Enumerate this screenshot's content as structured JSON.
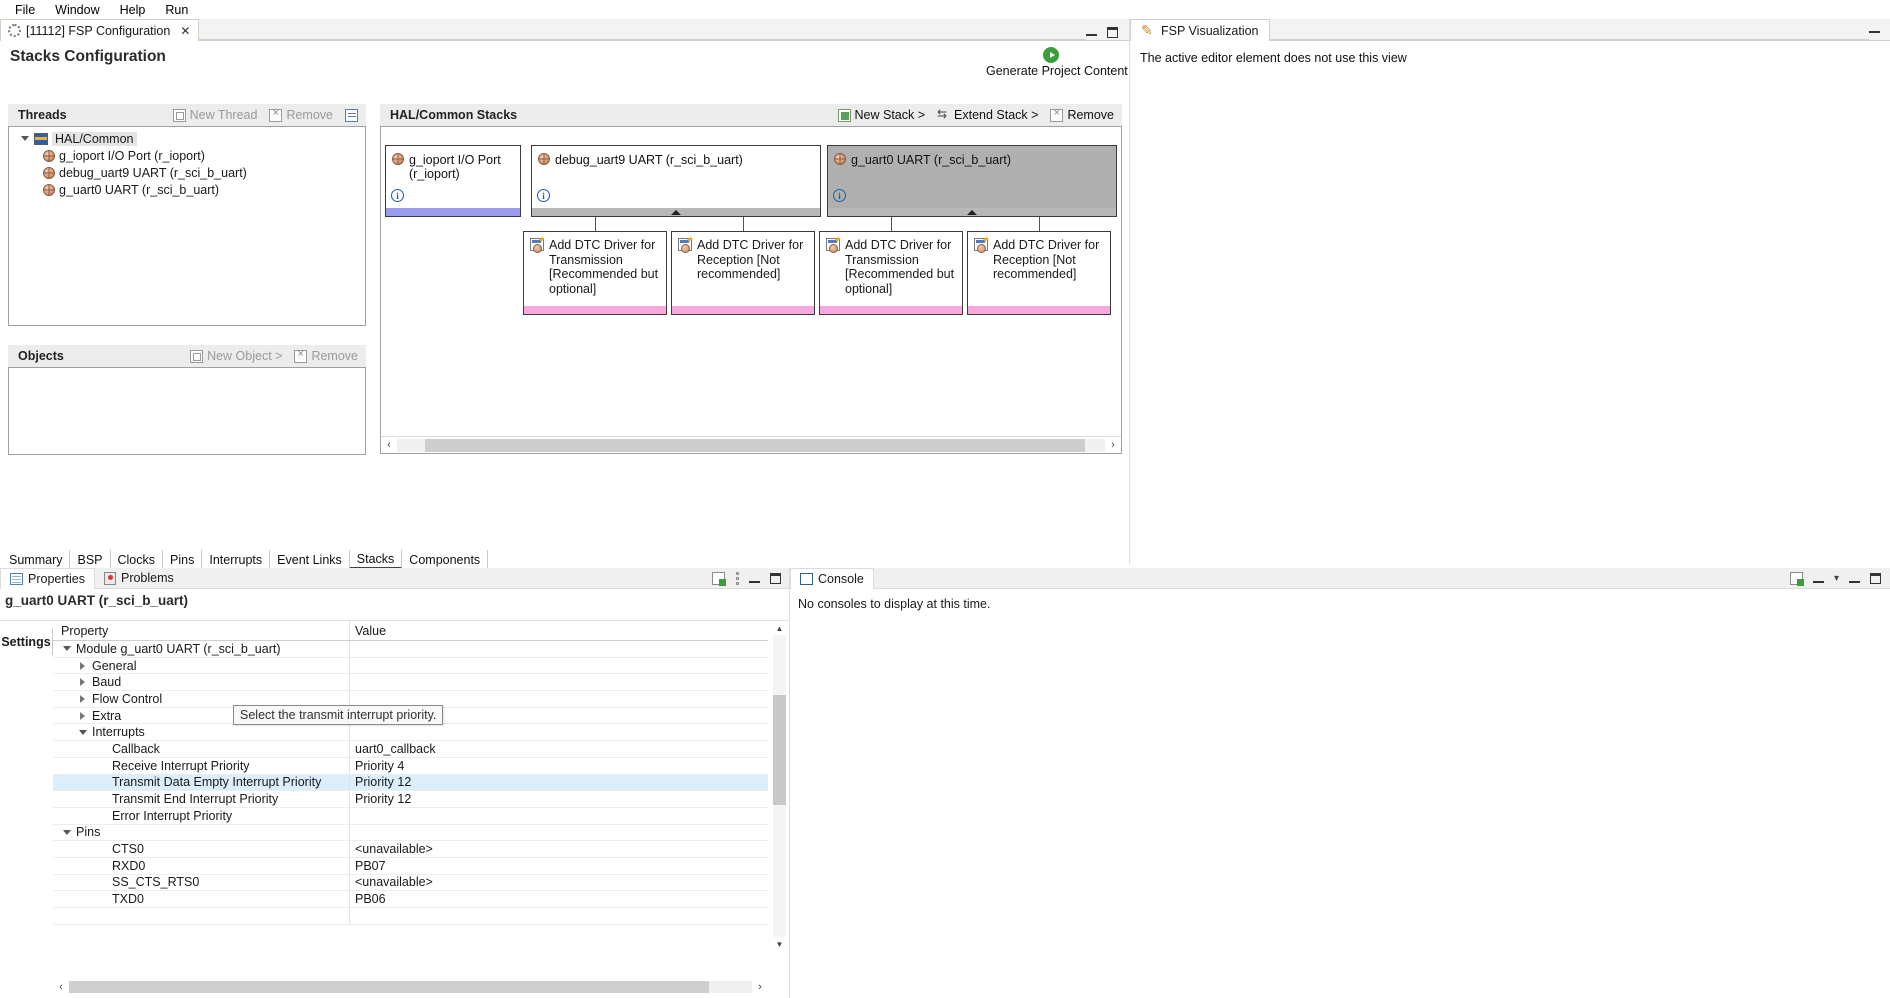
{
  "menu": {
    "items": [
      "File",
      "Window",
      "Help",
      "Run"
    ]
  },
  "editor": {
    "tab_label": "[11112] FSP Configuration",
    "close_icon": "✕",
    "title": "Stacks Configuration",
    "generate_label": "Generate Project Content",
    "generate_icon": "play-circle-icon",
    "window_minimize": "minimize-icon",
    "window_maximize": "maximize-icon"
  },
  "threads": {
    "header": "Threads",
    "new_thread": "New Thread",
    "remove": "Remove",
    "collapse_icon": "collapse-all-icon",
    "tree": [
      {
        "label": "HAL/Common",
        "icon": "hal-common-icon",
        "expanded": true,
        "selected": true
      },
      {
        "label": "g_ioport I/O Port (r_ioport)",
        "icon": "module-icon",
        "child": true
      },
      {
        "label": "debug_uart9 UART (r_sci_b_uart)",
        "icon": "module-icon",
        "child": true
      },
      {
        "label": "g_uart0 UART (r_sci_b_uart)",
        "icon": "module-icon",
        "child": true
      }
    ]
  },
  "objects": {
    "header": "Objects",
    "new_object": "New Object >",
    "remove": "Remove"
  },
  "stacks": {
    "header": "HAL/Common Stacks",
    "new_stack": "New Stack >",
    "extend_stack": "Extend Stack >",
    "remove": "Remove",
    "boxes": [
      {
        "label": "g_ioport I/O Port (r_ioport)",
        "bar": "blue",
        "selected": false,
        "info": true
      },
      {
        "label": "debug_uart9 UART (r_sci_b_uart)",
        "bar": "grey",
        "selected": false,
        "info": true
      },
      {
        "label": "g_uart0 UART (r_sci_b_uart)",
        "bar": "grey",
        "selected": true,
        "info": true
      }
    ],
    "drivers": [
      {
        "label": "Add DTC Driver for Transmission [Recommended but optional]"
      },
      {
        "label": "Add DTC Driver for Reception [Not recommended]"
      },
      {
        "label": "Add DTC Driver for Transmission [Recommended but optional]"
      },
      {
        "label": "Add DTC Driver for Reception [Not recommended]"
      }
    ],
    "scroll_left": "‹",
    "scroll_right": "›"
  },
  "bottom_tabs": {
    "items": [
      "Summary",
      "BSP",
      "Clocks",
      "Pins",
      "Interrupts",
      "Event Links",
      "Stacks",
      "Components"
    ],
    "active": "Stacks"
  },
  "visualization": {
    "tab_label": "FSP Visualization",
    "tab_icon": "pencil-icon",
    "message": "The active editor element does not use this view",
    "minimize": "minimize-icon"
  },
  "properties": {
    "tabs": [
      {
        "label": "Properties",
        "icon": "properties-icon",
        "active": true
      },
      {
        "label": "Problems",
        "icon": "problems-icon",
        "active": false
      }
    ],
    "toolbar": [
      "new-view-icon",
      "view-menu-icon",
      "minimize-icon",
      "maximize-icon"
    ],
    "title": "g_uart0 UART (r_sci_b_uart)",
    "settings_tab": "Settings",
    "columns": [
      "Property",
      "Value"
    ],
    "rows": [
      {
        "label": "Module g_uart0 UART (r_sci_b_uart)",
        "value": "",
        "indent": 0,
        "twisty": "down"
      },
      {
        "label": "General",
        "value": "",
        "indent": 1,
        "twisty": "right"
      },
      {
        "label": "Baud",
        "value": "",
        "indent": 1,
        "twisty": "right"
      },
      {
        "label": "Flow Control",
        "value": "",
        "indent": 1,
        "twisty": "right"
      },
      {
        "label": "Extra",
        "value": "",
        "indent": 1,
        "twisty": "right"
      },
      {
        "label": "Interrupts",
        "value": "",
        "indent": 1,
        "twisty": "down"
      },
      {
        "label": "Callback",
        "value": "uart0_callback",
        "indent": 2,
        "twisty": ""
      },
      {
        "label": "Receive Interrupt Priority",
        "value": "Priority 4",
        "indent": 2,
        "twisty": ""
      },
      {
        "label": "Transmit Data Empty Interrupt Priority",
        "value": "Priority 12",
        "indent": 2,
        "twisty": "",
        "highlight": true
      },
      {
        "label": "Transmit End Interrupt Priority",
        "value": "Priority 12",
        "indent": 2,
        "twisty": ""
      },
      {
        "label": "Error Interrupt Priority",
        "value": "",
        "indent": 2,
        "twisty": ""
      },
      {
        "label": "Pins",
        "value": "",
        "indent": 0,
        "twisty": "down"
      },
      {
        "label": "CTS0",
        "value": "<unavailable>",
        "indent": 2,
        "twisty": ""
      },
      {
        "label": "RXD0",
        "value": "PB07",
        "indent": 2,
        "twisty": ""
      },
      {
        "label": "SS_CTS_RTS0",
        "value": "<unavailable>",
        "indent": 2,
        "twisty": ""
      },
      {
        "label": "TXD0",
        "value": "PB06",
        "indent": 2,
        "twisty": ""
      },
      {
        "label": "",
        "value": "",
        "indent": 0,
        "twisty": ""
      }
    ],
    "tooltip": "Select the transmit interrupt priority.",
    "scroll_left": "‹",
    "scroll_right": "›",
    "scroll_up": "▲",
    "scroll_down": "▼"
  },
  "console": {
    "tab_label": "Console",
    "tab_icon": "console-icon",
    "message": "No consoles to display at this time.",
    "toolbar": [
      "new-console-icon",
      "display-selected-icon",
      "open-console-icon",
      "minimize-icon",
      "maximize-icon"
    ]
  }
}
